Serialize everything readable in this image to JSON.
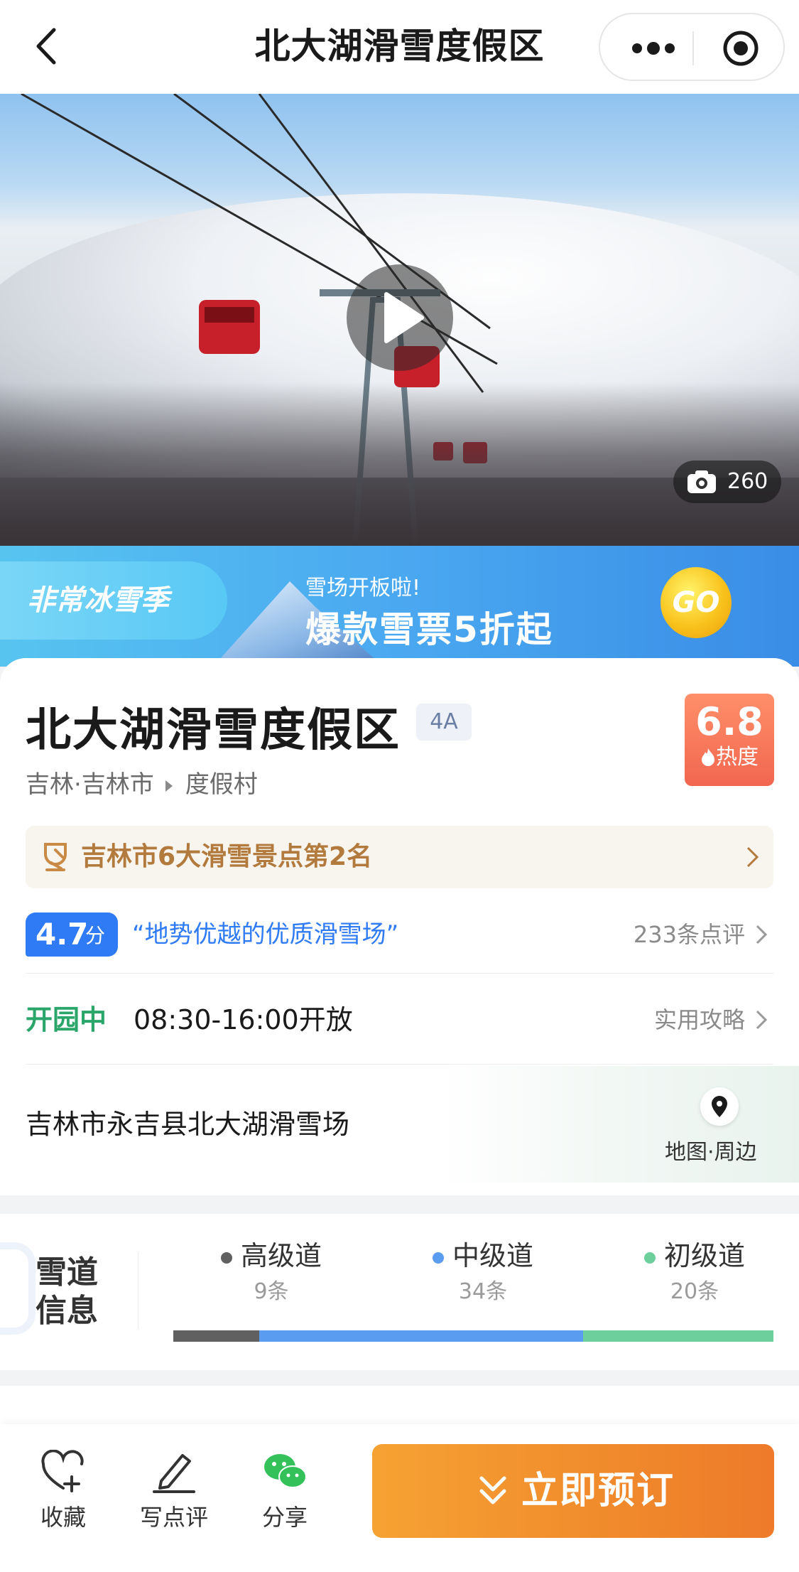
{
  "nav": {
    "title": "北大湖滑雪度假区"
  },
  "hero": {
    "photo_count": "260"
  },
  "banner": {
    "tag": "非常冰雪季",
    "subtitle": "雪场开板啦!",
    "headline": "爆款雪票5折起",
    "go_label": "GO"
  },
  "poi": {
    "name": "北大湖滑雪度假区",
    "grade": "4A",
    "heat_value": "6.8",
    "heat_label": "热度",
    "location": "吉林·吉林市",
    "category": "度假村"
  },
  "rank": {
    "text": "吉林市6大滑雪景点第2名"
  },
  "rating": {
    "score": "4.7",
    "unit": "分",
    "quote": "“地势优越的优质滑雪场”",
    "reviews": "233条点评"
  },
  "hours": {
    "status": "开园中",
    "time": "08:30-16:00开放",
    "guide": "实用攻略"
  },
  "address": {
    "text": "吉林市永吉县北大湖滑雪场",
    "map_label": "地图·周边"
  },
  "slopes": {
    "title_line1": "雪道",
    "title_line2": "信息",
    "levels": [
      {
        "name": "高级道",
        "count": "9条",
        "color": "#606060",
        "value": 9
      },
      {
        "name": "中级道",
        "count": "34条",
        "color": "#5a9cf0",
        "value": 34
      },
      {
        "name": "初级道",
        "count": "20条",
        "color": "#6ccf9c",
        "value": 20
      }
    ]
  },
  "bottom": {
    "favorite": "收藏",
    "review": "写点评",
    "share": "分享",
    "book": "立即预订"
  },
  "colors": {
    "accent_blue": "#2f7bf5",
    "open_green": "#2aa66a",
    "book_orange": "#f08a2c",
    "rank_brown": "#b27a3d"
  }
}
